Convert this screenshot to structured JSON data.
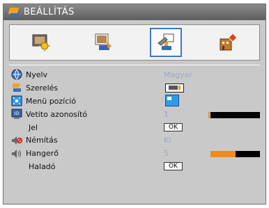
{
  "window": {
    "title": "BEÁLLÍTÁS"
  },
  "tabs": [
    {
      "id": "image",
      "icon": "image-settings-icon",
      "active": false
    },
    {
      "id": "display",
      "icon": "display-settings-icon",
      "active": false
    },
    {
      "id": "setup",
      "icon": "setup-icon",
      "active": true
    },
    {
      "id": "options",
      "icon": "options-icon",
      "active": false
    }
  ],
  "menu": {
    "language": {
      "label": "Nyelv",
      "value": "Magyar",
      "icon": "globe-icon"
    },
    "installation": {
      "label": "Szerelés",
      "icon": "installation-icon"
    },
    "menu_position": {
      "label": "Menü pozíció",
      "icon": "menu-position-icon"
    },
    "projector_id": {
      "label": "Vetito azonosító",
      "value": "1",
      "slider_fraction": 0.0,
      "icon": "projector-id-icon"
    },
    "signal": {
      "label": "Jel",
      "button": "OK"
    },
    "mute": {
      "label": "Némítás",
      "value": "Ki",
      "icon": "mute-icon"
    },
    "volume": {
      "label": "Hangerő",
      "value": "5",
      "slider_fraction": 0.5,
      "icon": "volume-icon"
    },
    "advanced": {
      "label": "Haladó",
      "button": "OK"
    }
  },
  "colors": {
    "accent": "#3c78c8",
    "slider_fill": "#f08a1a",
    "value_text": "#9aa9c4"
  }
}
